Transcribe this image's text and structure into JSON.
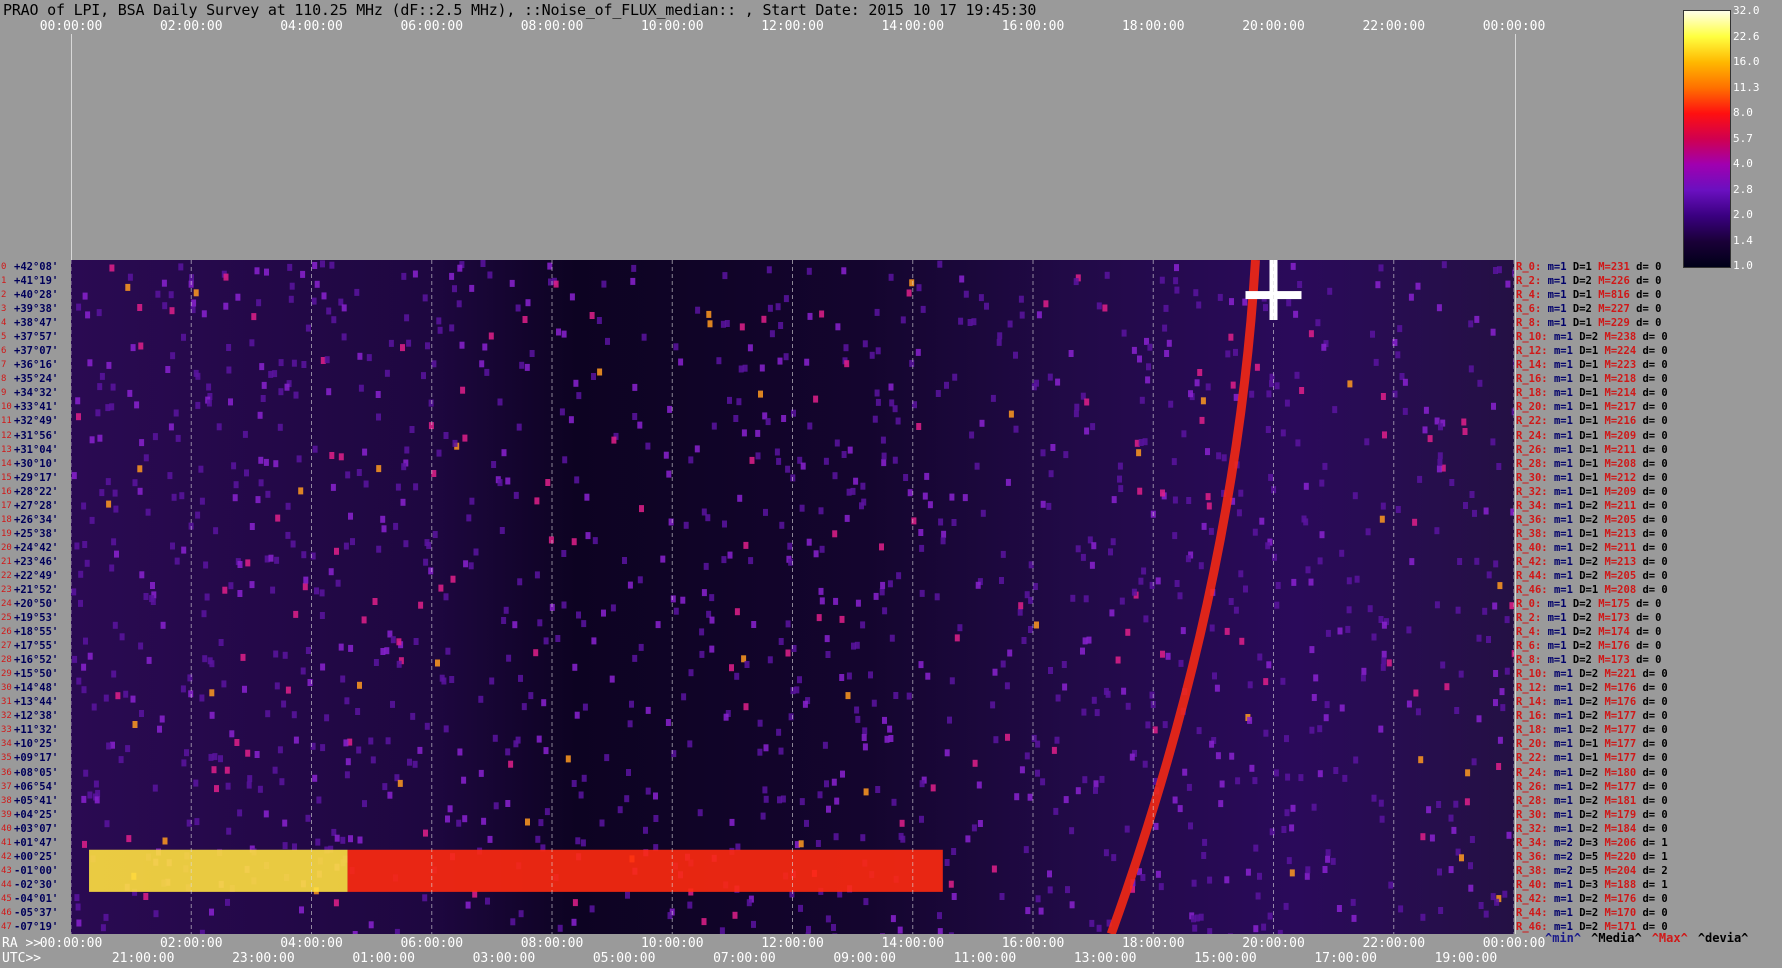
{
  "title": "PRAO of LPI, BSA Daily Survey at 110.25 MHz (dF::2.5 MHz), ::Noise_of_FLUX_median:: , Start Date: 2015 10 17 19:45:30",
  "top_axis": {
    "ticks": [
      "00:00:00",
      "02:00:00",
      "04:00:00",
      "06:00:00",
      "08:00:00",
      "10:00:00",
      "12:00:00",
      "14:00:00",
      "16:00:00",
      "18:00:00",
      "20:00:00",
      "22:00:00",
      "00:00:00"
    ]
  },
  "ra_axis": {
    "prefix": "RA >>",
    "ticks": [
      "00:00:00",
      "02:00:00",
      "04:00:00",
      "06:00:00",
      "08:00:00",
      "10:00:00",
      "12:00:00",
      "14:00:00",
      "16:00:00",
      "18:00:00",
      "20:00:00",
      "22:00:00",
      "00:00:00"
    ]
  },
  "utc_axis": {
    "prefix": "UTC>>",
    "ticks": [
      "21:00:00",
      "23:00:00",
      "01:00:00",
      "03:00:00",
      "05:00:00",
      "07:00:00",
      "09:00:00",
      "11:00:00",
      "13:00:00",
      "15:00:00",
      "17:00:00",
      "19:00:00"
    ]
  },
  "declinations": [
    "+42°08'",
    "+41°19'",
    "+40°28'",
    "+39°38'",
    "+38°47'",
    "+37°57'",
    "+37°07'",
    "+36°16'",
    "+35°24'",
    "+34°32'",
    "+33°41'",
    "+32°49'",
    "+31°56'",
    "+31°04'",
    "+30°10'",
    "+29°17'",
    "+28°22'",
    "+27°28'",
    "+26°34'",
    "+25°38'",
    "+24°42'",
    "+23°46'",
    "+22°49'",
    "+21°52'",
    "+20°50'",
    "+19°53'",
    "+18°55'",
    "+17°55'",
    "+16°52'",
    "+15°50'",
    "+14°48'",
    "+13°44'",
    "+12°38'",
    "+11°32'",
    "+10°25'",
    "+09°17'",
    "+08°05'",
    "+06°54'",
    "+05°41'",
    "+04°25'",
    "+03°07'",
    "+01°47'",
    "+00°25'",
    "-01°00'",
    "-02°30'",
    "-04°01'",
    "-05°37'",
    "-07°19'"
  ],
  "beams": [
    {
      "id": "R_0:",
      "m": "m=1",
      "D": "D=1",
      "M": "M=231",
      "d": "d= 0"
    },
    {
      "id": "R_2:",
      "m": "m=1",
      "D": "D=2",
      "M": "M=226",
      "d": "d= 0"
    },
    {
      "id": "R_4:",
      "m": "m=1",
      "D": "D=1",
      "M": "M=816",
      "d": "d= 0"
    },
    {
      "id": "R_6:",
      "m": "m=1",
      "D": "D=2",
      "M": "M=227",
      "d": "d= 0"
    },
    {
      "id": "R_8:",
      "m": "m=1",
      "D": "D=1",
      "M": "M=229",
      "d": "d= 0"
    },
    {
      "id": "R_10:",
      "m": "m=1",
      "D": "D=2",
      "M": "M=238",
      "d": "d= 0"
    },
    {
      "id": "R_12:",
      "m": "m=1",
      "D": "D=1",
      "M": "M=224",
      "d": "d= 0"
    },
    {
      "id": "R_14:",
      "m": "m=1",
      "D": "D=1",
      "M": "M=223",
      "d": "d= 0"
    },
    {
      "id": "R_16:",
      "m": "m=1",
      "D": "D=1",
      "M": "M=218",
      "d": "d= 0"
    },
    {
      "id": "R_18:",
      "m": "m=1",
      "D": "D=1",
      "M": "M=214",
      "d": "d= 0"
    },
    {
      "id": "R_20:",
      "m": "m=1",
      "D": "D=1",
      "M": "M=217",
      "d": "d= 0"
    },
    {
      "id": "R_22:",
      "m": "m=1",
      "D": "D=1",
      "M": "M=216",
      "d": "d= 0"
    },
    {
      "id": "R_24:",
      "m": "m=1",
      "D": "D=1",
      "M": "M=209",
      "d": "d= 0"
    },
    {
      "id": "R_26:",
      "m": "m=1",
      "D": "D=1",
      "M": "M=211",
      "d": "d= 0"
    },
    {
      "id": "R_28:",
      "m": "m=1",
      "D": "D=1",
      "M": "M=208",
      "d": "d= 0"
    },
    {
      "id": "R_30:",
      "m": "m=1",
      "D": "D=1",
      "M": "M=212",
      "d": "d= 0"
    },
    {
      "id": "R_32:",
      "m": "m=1",
      "D": "D=1",
      "M": "M=209",
      "d": "d= 0"
    },
    {
      "id": "R_34:",
      "m": "m=1",
      "D": "D=2",
      "M": "M=211",
      "d": "d= 0"
    },
    {
      "id": "R_36:",
      "m": "m=1",
      "D": "D=2",
      "M": "M=205",
      "d": "d= 0"
    },
    {
      "id": "R_38:",
      "m": "m=1",
      "D": "D=1",
      "M": "M=213",
      "d": "d= 0"
    },
    {
      "id": "R_40:",
      "m": "m=1",
      "D": "D=2",
      "M": "M=211",
      "d": "d= 0"
    },
    {
      "id": "R_42:",
      "m": "m=1",
      "D": "D=2",
      "M": "M=213",
      "d": "d= 0"
    },
    {
      "id": "R_44:",
      "m": "m=1",
      "D": "D=2",
      "M": "M=205",
      "d": "d= 0"
    },
    {
      "id": "R_46:",
      "m": "m=1",
      "D": "D=1",
      "M": "M=208",
      "d": "d= 0"
    },
    {
      "id": "R_0:",
      "m": "m=1",
      "D": "D=2",
      "M": "M=175",
      "d": "d= 0"
    },
    {
      "id": "R_2:",
      "m": "m=1",
      "D": "D=2",
      "M": "M=173",
      "d": "d= 0"
    },
    {
      "id": "R_4:",
      "m": "m=1",
      "D": "D=2",
      "M": "M=174",
      "d": "d= 0"
    },
    {
      "id": "R_6:",
      "m": "m=1",
      "D": "D=2",
      "M": "M=176",
      "d": "d= 0"
    },
    {
      "id": "R_8:",
      "m": "m=1",
      "D": "D=2",
      "M": "M=173",
      "d": "d= 0"
    },
    {
      "id": "R_10:",
      "m": "m=1",
      "D": "D=2",
      "M": "M=221",
      "d": "d= 0"
    },
    {
      "id": "R_12:",
      "m": "m=1",
      "D": "D=2",
      "M": "M=176",
      "d": "d= 0"
    },
    {
      "id": "R_14:",
      "m": "m=1",
      "D": "D=2",
      "M": "M=176",
      "d": "d= 0"
    },
    {
      "id": "R_16:",
      "m": "m=1",
      "D": "D=2",
      "M": "M=177",
      "d": "d= 0"
    },
    {
      "id": "R_18:",
      "m": "m=1",
      "D": "D=2",
      "M": "M=177",
      "d": "d= 0"
    },
    {
      "id": "R_20:",
      "m": "m=1",
      "D": "D=1",
      "M": "M=177",
      "d": "d= 0"
    },
    {
      "id": "R_22:",
      "m": "m=1",
      "D": "D=1",
      "M": "M=177",
      "d": "d= 0"
    },
    {
      "id": "R_24:",
      "m": "m=1",
      "D": "D=2",
      "M": "M=180",
      "d": "d= 0"
    },
    {
      "id": "R_26:",
      "m": "m=1",
      "D": "D=2",
      "M": "M=177",
      "d": "d= 0"
    },
    {
      "id": "R_28:",
      "m": "m=1",
      "D": "D=2",
      "M": "M=181",
      "d": "d= 0"
    },
    {
      "id": "R_30:",
      "m": "m=1",
      "D": "D=2",
      "M": "M=179",
      "d": "d= 0"
    },
    {
      "id": "R_32:",
      "m": "m=1",
      "D": "D=2",
      "M": "M=184",
      "d": "d= 0"
    },
    {
      "id": "R_34:",
      "m": "m=2",
      "D": "D=3",
      "M": "M=206",
      "d": "d= 1"
    },
    {
      "id": "R_36:",
      "m": "m=2",
      "D": "D=5",
      "M": "M=220",
      "d": "d= 1"
    },
    {
      "id": "R_38:",
      "m": "m=2",
      "D": "D=5",
      "M": "M=204",
      "d": "d= 2"
    },
    {
      "id": "R_40:",
      "m": "m=1",
      "D": "D=3",
      "M": "M=188",
      "d": "d= 1"
    },
    {
      "id": "R_42:",
      "m": "m=1",
      "D": "D=2",
      "M": "M=176",
      "d": "d= 0"
    },
    {
      "id": "R_44:",
      "m": "m=1",
      "D": "D=2",
      "M": "M=170",
      "d": "d= 0"
    },
    {
      "id": "R_46:",
      "m": "m=1",
      "D": "D=2",
      "M": "M=171",
      "d": "d= 0"
    }
  ],
  "legend_bottom": [
    {
      "text": "^min^",
      "color": "#1a1a8a"
    },
    {
      "text": "^Media^",
      "color": "#000000"
    },
    {
      "text": "^Max^",
      "color": "#d01818"
    },
    {
      "text": "^devia^",
      "color": "#000000"
    }
  ],
  "colorbar": {
    "labels": [
      "32.0",
      "22.6",
      "16.0",
      "11.3",
      "8.0",
      "5.7",
      "4.0",
      "2.8",
      "2.0",
      "1.4",
      "1.0"
    ],
    "colors": [
      "#000018",
      "#1a0038",
      "#3a0080",
      "#6a10c0",
      "#a000b0",
      "#d00050",
      "#ff1010",
      "#ff7000",
      "#ffb800",
      "#ffff40",
      "#ffffe8"
    ]
  },
  "chart_data": {
    "type": "heatmap",
    "title": "PRAO of LPI, BSA Daily Survey at 110.25 MHz (dF::2.5 MHz), ::Noise_of_FLUX_median:: , Start Date: 2015 10 17 19:45:30",
    "xlabel": "RA",
    "x_ticks": [
      "00:00:00",
      "02:00:00",
      "04:00:00",
      "06:00:00",
      "08:00:00",
      "10:00:00",
      "12:00:00",
      "14:00:00",
      "16:00:00",
      "18:00:00",
      "20:00:00",
      "22:00:00",
      "00:00:00"
    ],
    "x2label": "UTC",
    "x2_ticks": [
      "21:00:00",
      "23:00:00",
      "01:00:00",
      "03:00:00",
      "05:00:00",
      "07:00:00",
      "09:00:00",
      "11:00:00",
      "13:00:00",
      "15:00:00",
      "17:00:00",
      "19:00:00"
    ],
    "y_rows": 48,
    "color_scale": {
      "min": 1.0,
      "max": 32.0,
      "scale": "log2"
    },
    "features": [
      {
        "kind": "horizontal-band",
        "rows": [
          42,
          44
        ],
        "x_range_hours": [
          0.3,
          4.6
        ],
        "level": 22.6
      },
      {
        "kind": "horizontal-band",
        "rows": [
          42,
          44
        ],
        "x_range_hours": [
          4.6,
          14.5
        ],
        "level": 8.0
      },
      {
        "kind": "diagonal-ridge",
        "x_start_hours": 19.7,
        "x_end_hours": 17.3,
        "level": 8.0
      },
      {
        "kind": "bright-source",
        "x_hours": 20.0,
        "row": 2,
        "level": 32.0
      }
    ]
  }
}
